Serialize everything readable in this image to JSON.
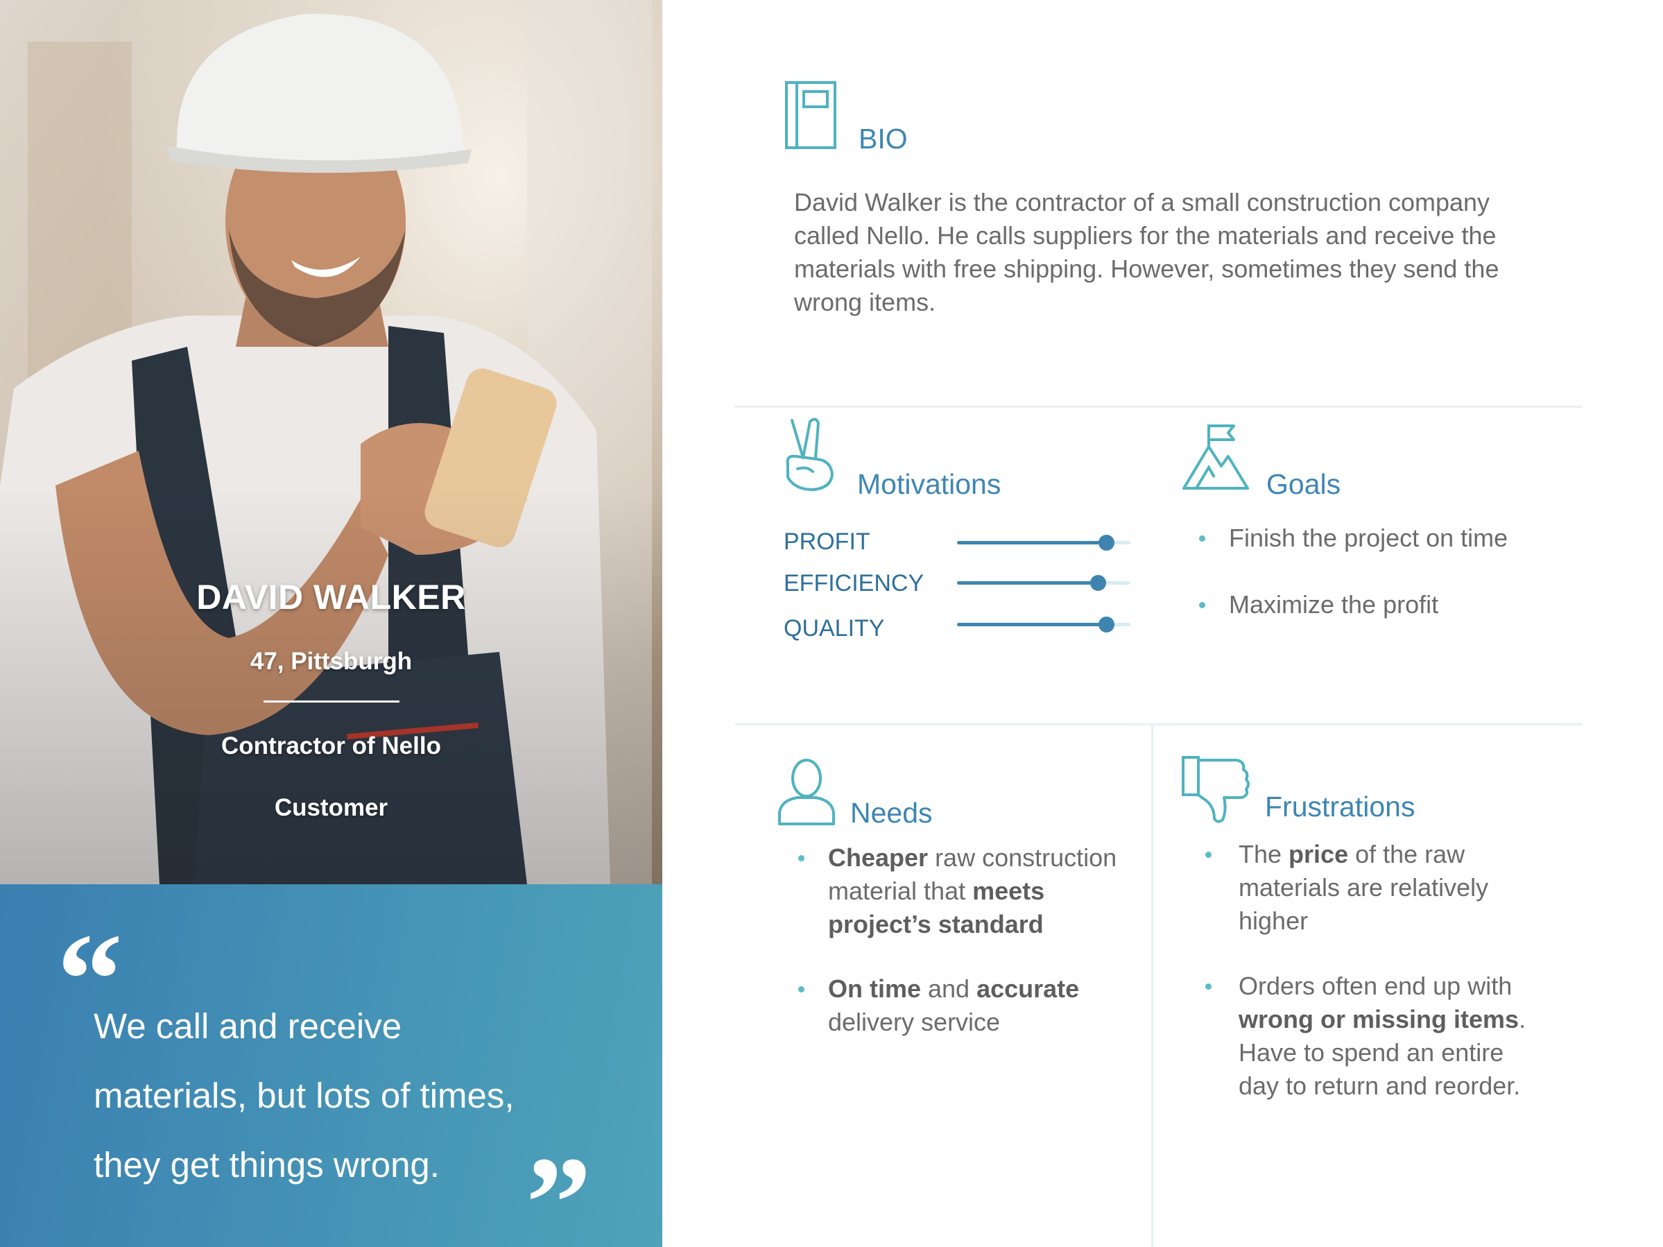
{
  "persona": {
    "name": "DAVID WALKER",
    "age_location": "47, Pittsburgh",
    "role": "Contractor of  Nello",
    "type": "Customer"
  },
  "quote": {
    "open_mark": "“",
    "close_mark": "”",
    "lines": [
      "We call and receive",
      "materials, but lots of times,",
      "they get things wrong."
    ]
  },
  "bio": {
    "icon": "book-icon",
    "title": "BIO",
    "lines": [
      "David  Walker is  the contractor of a small construction company",
      "called Nello. He calls suppliers for the materials and receive the",
      "materials with free shipping. However, sometimes they send the",
      "wrong items."
    ]
  },
  "motivations": {
    "icon": "peace-hand-icon",
    "title": "Motivations",
    "items": [
      {
        "label": "PROFIT",
        "level": 0.86
      },
      {
        "label": "EFFICIENCY",
        "level": 0.81
      },
      {
        "label": "QUALITY",
        "level": 0.86
      }
    ]
  },
  "goals": {
    "icon": "mountain-flag-icon",
    "title": "Goals",
    "items": [
      "Finish the project on time",
      "Maximize the profit"
    ]
  },
  "needs": {
    "icon": "person-icon",
    "title": "Needs",
    "items": [
      {
        "lines": [
          [
            {
              "t": "Cheaper",
              "b": true
            },
            {
              "t": " raw construction",
              "b": false
            }
          ],
          [
            {
              "t": "material that ",
              "b": false
            },
            {
              "t": "meets",
              "b": true
            }
          ],
          [
            {
              "t": "project’s standard",
              "b": true
            }
          ]
        ]
      },
      {
        "lines": [
          [
            {
              "t": "On time",
              "b": true
            },
            {
              "t": " and ",
              "b": false
            },
            {
              "t": "accurate",
              "b": true
            }
          ],
          [
            {
              "t": "delivery service",
              "b": false
            }
          ]
        ]
      }
    ]
  },
  "frustrations": {
    "icon": "thumbs-down-icon",
    "title": "Frustrations",
    "items": [
      {
        "lines": [
          [
            {
              "t": "The ",
              "b": false
            },
            {
              "t": "price",
              "b": true
            },
            {
              "t": " of the raw",
              "b": false
            }
          ],
          [
            {
              "t": "materials are relatively",
              "b": false
            }
          ],
          [
            {
              "t": "higher",
              "b": false
            }
          ]
        ]
      },
      {
        "lines": [
          [
            {
              "t": "Orders often end up with",
              "b": false
            }
          ],
          [
            {
              "t": "wrong or missing items",
              "b": true
            },
            {
              "t": ".",
              "b": false
            }
          ],
          [
            {
              "t": "Have to spend an entire",
              "b": false
            }
          ],
          [
            {
              "t": "day to return and reorder.",
              "b": false
            }
          ]
        ]
      }
    ]
  },
  "colors": {
    "accent": "#3d86b3",
    "icon_teal": "#4fb3bf",
    "quote_panel": "#4593b6"
  }
}
